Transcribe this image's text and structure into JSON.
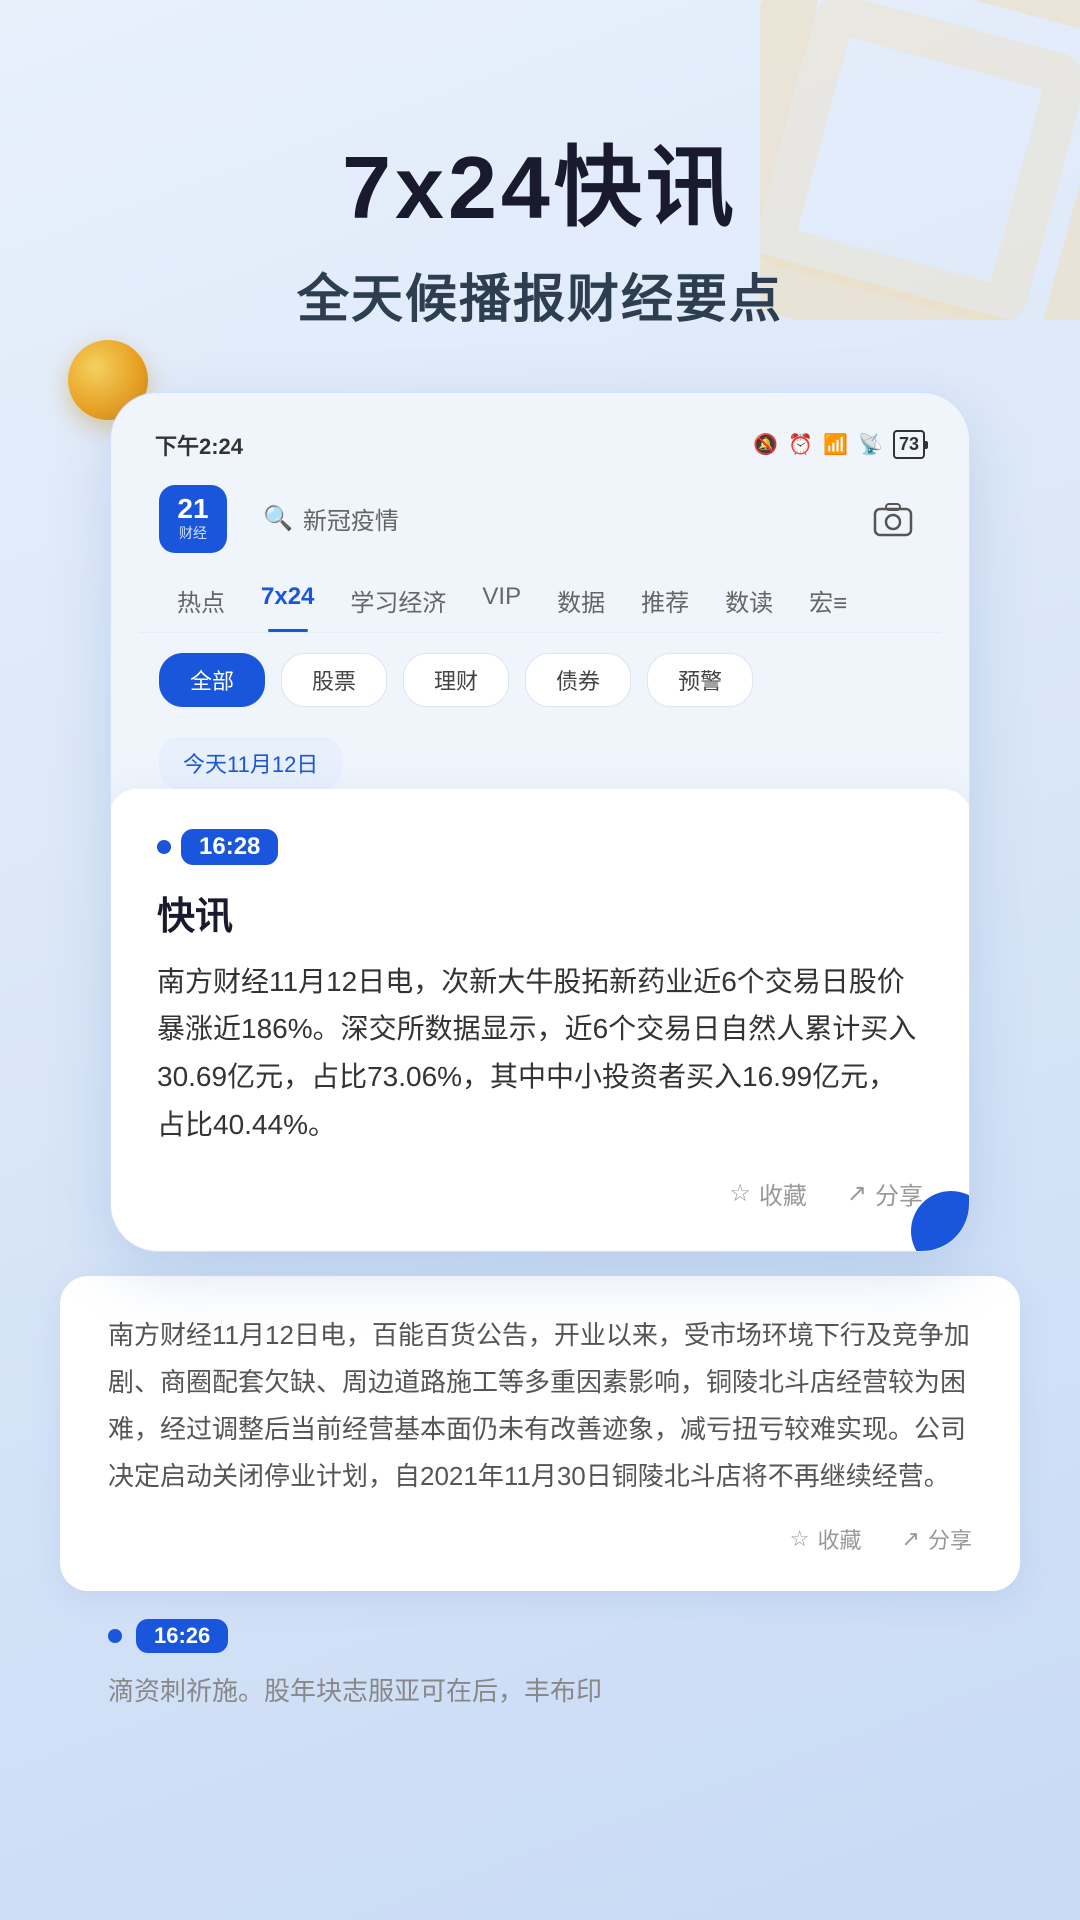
{
  "page": {
    "bg_color": "#dce8f8"
  },
  "hero": {
    "title": "7x24快讯",
    "subtitle": "全天候播报财经要点"
  },
  "phone": {
    "status_bar": {
      "time": "下午2:24",
      "battery": "73"
    },
    "search_placeholder": "新冠疫情",
    "logo_number": "21",
    "logo_sub": "财经",
    "nav_tabs": [
      {
        "label": "热点",
        "active": false
      },
      {
        "label": "7x24",
        "active": true
      },
      {
        "label": "学习经济",
        "active": false
      },
      {
        "label": "VIP",
        "active": false
      },
      {
        "label": "数据",
        "active": false
      },
      {
        "label": "推荐",
        "active": false
      },
      {
        "label": "数读",
        "active": false
      },
      {
        "label": "宏≡",
        "active": false
      }
    ],
    "filter_chips": [
      {
        "label": "全部",
        "active": true
      },
      {
        "label": "股票",
        "active": false
      },
      {
        "label": "理财",
        "active": false
      },
      {
        "label": "债券",
        "active": false
      },
      {
        "label": "预警",
        "active": false
      }
    ],
    "date_label": "今天11月12日"
  },
  "news_card": {
    "time": "16:28",
    "title": "快讯",
    "body": "南方财经11月12日电，次新大牛股拓新药业近6个交易日股价暴涨近186%。深交所数据显示，近6个交易日自然人累计买入30.69亿元，占比73.06%，其中中小投资者买入16.99亿元，占比40.44%。",
    "save_label": "收藏",
    "share_label": "分享"
  },
  "second_card": {
    "body": "南方财经11月12日电，百能百货公告，开业以来，受市场环境下行及竞争加剧、商圈配套欠缺、周边道路施工等多重因素影响，铜陵北斗店经营较为困难，经过调整后当前经营基本面仍未有改善迹象，减亏扭亏较难实现。公司决定启动关闭停业计划，自2021年11月30日铜陵北斗店将不再继续经营。",
    "save_label": "收藏",
    "share_label": "分享"
  },
  "third_item": {
    "time": "16:26",
    "preview": "滴资刺祈施。股年块志服亚可在后，丰布印"
  }
}
